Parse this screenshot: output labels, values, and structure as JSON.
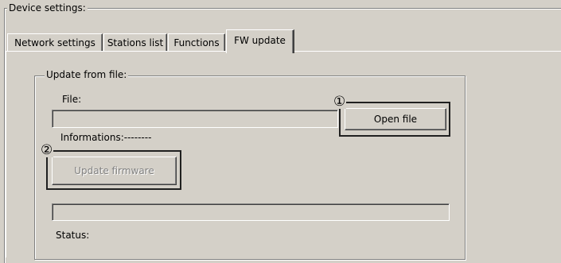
{
  "device_settings": {
    "legend": "Device settings:"
  },
  "tabs": [
    {
      "label": "Network settings",
      "active": false
    },
    {
      "label": "Stations list",
      "active": false
    },
    {
      "label": "Functions",
      "active": false
    },
    {
      "label": "FW update",
      "active": true
    }
  ],
  "update_group": {
    "legend": "Update from file:",
    "file_label": "File:",
    "file_value": "",
    "open_file_button": "Open file",
    "informations_label": "Informations:--------",
    "update_firmware_button": "Update firmware",
    "update_firmware_enabled": false,
    "progress": 0,
    "status_label": "Status:"
  },
  "callouts": {
    "open_file_marker": "①",
    "update_firmware_marker": "②"
  },
  "colors": {
    "face": "#d4d0c8",
    "shadow": "#808080",
    "highlight": "#ffffff",
    "dark": "#404040"
  }
}
